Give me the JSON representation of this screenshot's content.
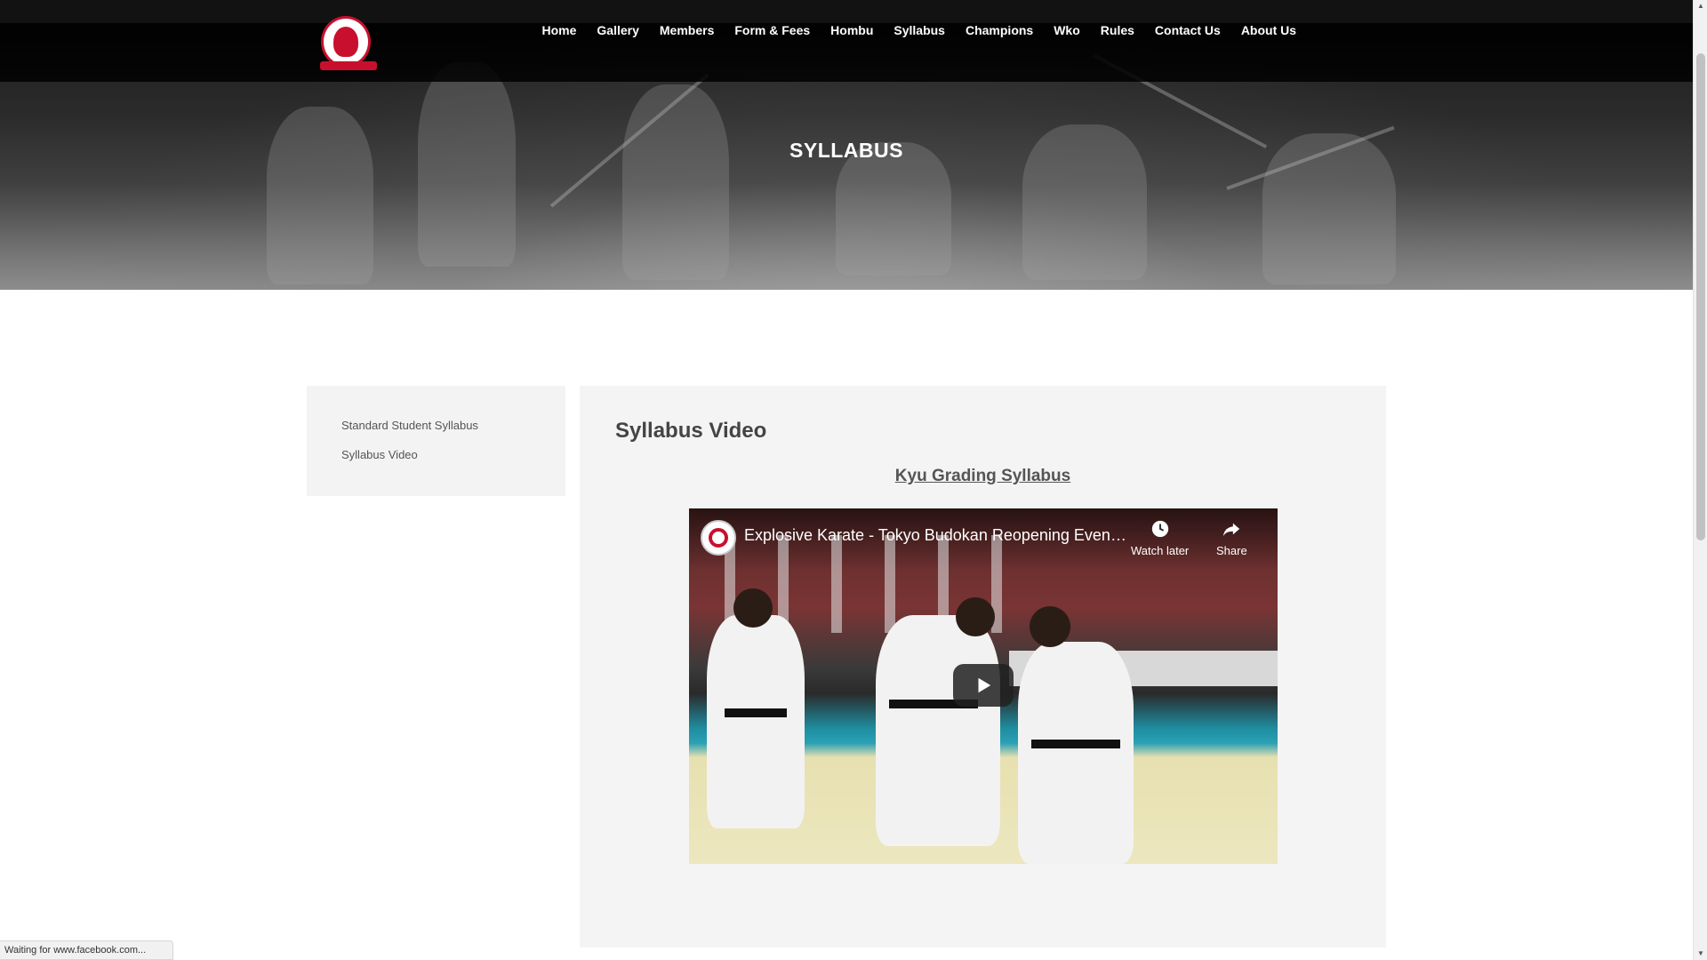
{
  "nav": {
    "logo": "club-logo",
    "items": [
      {
        "label": "Home"
      },
      {
        "label": "Gallery"
      },
      {
        "label": "Members"
      },
      {
        "label": "Form & Fees"
      },
      {
        "label": "Hombu"
      },
      {
        "label": "Syllabus"
      },
      {
        "label": "Champions"
      },
      {
        "label": "Wko"
      },
      {
        "label": "Rules"
      },
      {
        "label": "Contact Us"
      },
      {
        "label": "About Us"
      }
    ]
  },
  "hero": {
    "title": "SYLLABUS"
  },
  "sidebar": {
    "items": [
      {
        "label": "Standard Student Syllabus"
      },
      {
        "label": "Syllabus Video"
      }
    ]
  },
  "main": {
    "title": "Syllabus Video",
    "subtitle": "Kyu Grading Syllabus"
  },
  "video": {
    "title": "Explosive Karate - Tokyo Budokan Reopening Events...",
    "watch_later": "Watch later",
    "share": "Share"
  },
  "status": {
    "text": "Waiting for www.facebook.com..."
  },
  "colors": {
    "accent": "#c8102e",
    "nav_bg": "#000000",
    "panel_bg": "#f4f4f4"
  }
}
